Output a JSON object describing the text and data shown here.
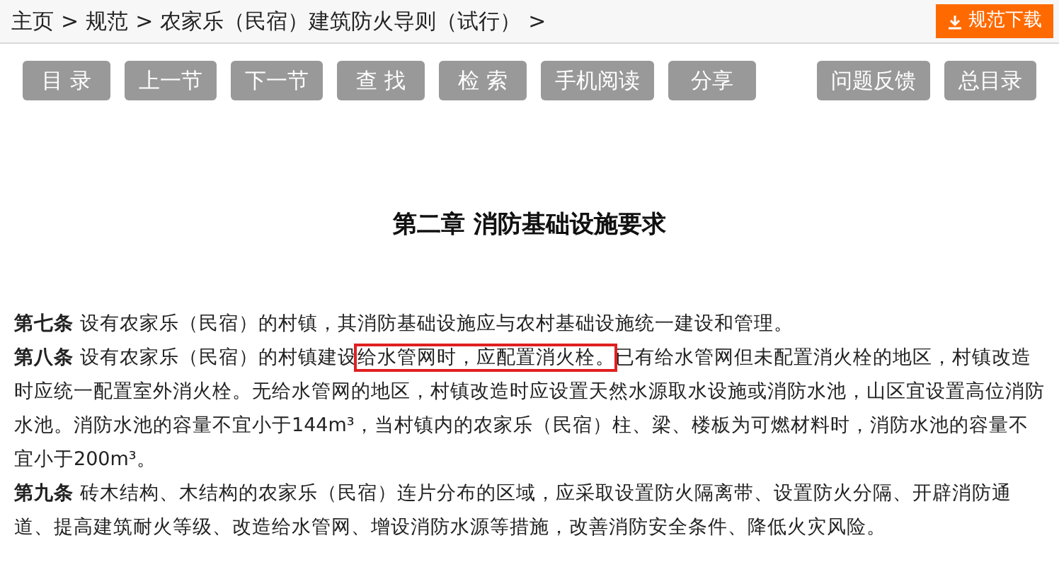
{
  "breadcrumb": [
    {
      "label": "主页",
      "separator": ">"
    },
    {
      "label": "规范",
      "separator": ">"
    },
    {
      "label": "农家乐（民宿）建筑防火导则（试行）",
      "separator": ">"
    }
  ],
  "download_button": "规范下载",
  "toolbar_left": [
    "目 录",
    "上一节",
    "下一节",
    "查 找",
    "检 索",
    "手机阅读",
    "分享"
  ],
  "toolbar_right": [
    "问题反馈",
    "总目录"
  ],
  "chapter_title": "第二章 消防基础设施要求",
  "articles": [
    {
      "number": "第七条",
      "segments": [
        {
          "text": "设有农家乐（民宿）的村镇，其消防基础设施应与农村基础设施统一建设和管理。",
          "highlighted": false
        }
      ]
    },
    {
      "number": "第八条",
      "segments": [
        {
          "text": "设有农家乐（民宿）的村镇建设",
          "highlighted": false
        },
        {
          "text": "给水管网时，应配置消火栓。",
          "highlighted": true
        },
        {
          "text": "已有给水管网但未配置消火栓的地区，村镇改造时应统一配置室外消火栓。无给水管网的地区，村镇改造时应设置天然水源取水设施或消防水池，山区宜设置高位消防水池。消防水池的容量不宜小于144m³，当村镇内的农家乐（民宿）柱、梁、楼板为可燃材料时，消防水池的容量不宜小于200m³。",
          "highlighted": false
        }
      ]
    },
    {
      "number": "第九条",
      "segments": [
        {
          "text": "砖木结构、木结构的农家乐（民宿）连片分布的区域，应采取设置防火隔离带、设置防火分隔、开辟消防通道、提高建筑耐火等级、改造给水管网、增设消防水源等措施，改善消防安全条件、降低火灾风险。",
          "highlighted": false
        }
      ]
    }
  ]
}
